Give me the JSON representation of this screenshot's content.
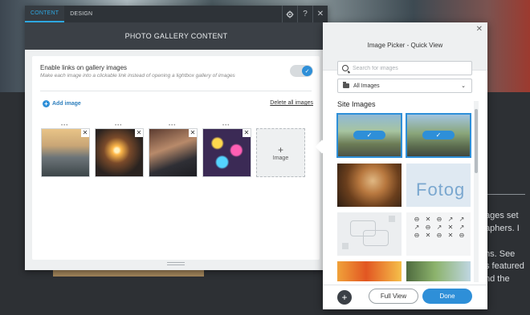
{
  "panel": {
    "tabs": [
      {
        "label": "CONTENT"
      },
      {
        "label": "DESIGN"
      }
    ],
    "toolbar_icons": [
      "gear-icon",
      "help-icon",
      "close-icon"
    ],
    "help_label": "?",
    "close_label": "✕",
    "title": "PHOTO GALLERY CONTENT",
    "option": {
      "title": "Enable links on gallery images",
      "description": "Make each image into a clickable link instead of opening a lightbox gallery of images",
      "enabled": true
    },
    "add_image_label": "Add image",
    "delete_all_label": "Delete all images",
    "add_tile": {
      "plus": "+",
      "label": "Image"
    },
    "thumb_close": "✕"
  },
  "picker": {
    "title": "Image Picker - Quick View",
    "close": "✕",
    "search_placeholder": "Search for images",
    "folder": "All Images",
    "section_title": "Site Images",
    "selected_badge": "✓",
    "fotog_text": "Fotog",
    "glyphs": [
      "⊖",
      "✕",
      "⊖",
      "↗",
      "↗",
      "↗",
      "⊖",
      "↗",
      "✕",
      "↗",
      "⊖",
      "✕",
      "⊖",
      "✕",
      "⊖"
    ],
    "fab": "+",
    "full_view": "Full View",
    "done": "Done"
  },
  "background": {
    "text_lines": [
      "ages set",
      "aphers. I",
      "",
      "hs. See",
      "s featured",
      "nd the"
    ]
  },
  "colors": {
    "accent": "#2e8fd8",
    "bar": "#2e3338",
    "title_bar": "#3b4046"
  }
}
